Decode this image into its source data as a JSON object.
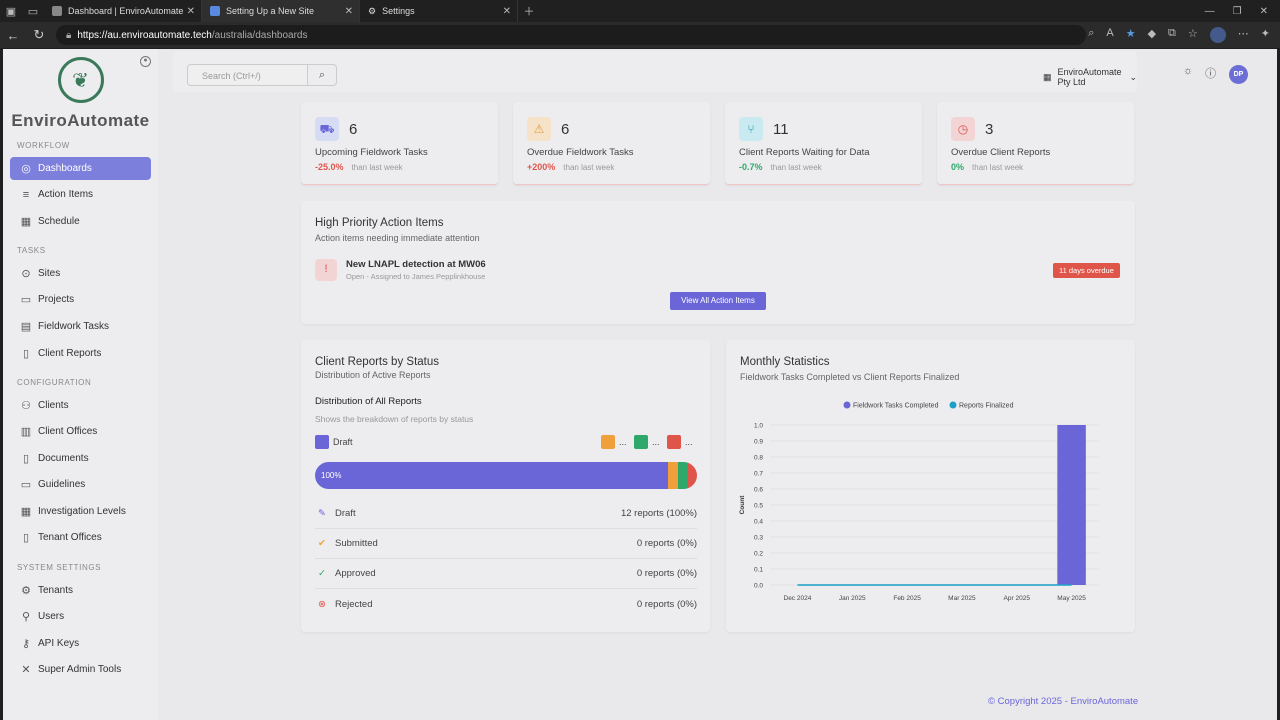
{
  "browser": {
    "tabs": [
      {
        "title": "Dashboard | EnviroAutomate",
        "active": false
      },
      {
        "title": "Setting Up a New Site",
        "active": true
      },
      {
        "title": "Settings",
        "active": false
      }
    ],
    "url_host": "https://au.enviroautomate.tech",
    "url_path": "/australia/dashboards"
  },
  "brand": {
    "name": "EnviroAutomate"
  },
  "sidebar": {
    "sections": [
      {
        "title": "WORKFLOW",
        "items": [
          {
            "label": "Dashboards",
            "icon": "dashboard-icon",
            "active": true
          },
          {
            "label": "Action Items",
            "icon": "list-icon"
          },
          {
            "label": "Schedule",
            "icon": "calendar-icon"
          }
        ]
      },
      {
        "title": "TASKS",
        "items": [
          {
            "label": "Sites",
            "icon": "location-icon"
          },
          {
            "label": "Projects",
            "icon": "folder-icon"
          },
          {
            "label": "Fieldwork Tasks",
            "icon": "clipboard-icon"
          },
          {
            "label": "Client Reports",
            "icon": "report-icon"
          }
        ]
      },
      {
        "title": "CONFIGURATION",
        "items": [
          {
            "label": "Clients",
            "icon": "users-icon"
          },
          {
            "label": "Client Offices",
            "icon": "building-icon"
          },
          {
            "label": "Documents",
            "icon": "document-icon"
          },
          {
            "label": "Guidelines",
            "icon": "book-icon"
          },
          {
            "label": "Investigation Levels",
            "icon": "chart-icon"
          },
          {
            "label": "Tenant Offices",
            "icon": "office-icon"
          }
        ]
      },
      {
        "title": "SYSTEM SETTINGS",
        "items": [
          {
            "label": "Tenants",
            "icon": "gear-icon"
          },
          {
            "label": "Users",
            "icon": "user-icon"
          },
          {
            "label": "API Keys",
            "icon": "key-icon"
          },
          {
            "label": "Super Admin Tools",
            "icon": "tools-icon"
          }
        ]
      }
    ]
  },
  "topbar": {
    "search_placeholder": "Search (Ctrl+/)",
    "company": "EnviroAutomate Pty Ltd",
    "user_initials": "DP"
  },
  "stats": [
    {
      "value": "6",
      "label": "Upcoming Fieldwork Tasks",
      "change": "-25.0%",
      "change_color": "#e0554a",
      "tail": "than last week",
      "icon": "truck-icon",
      "icon_bg": "#d7dcf5",
      "icon_color": "#6a66d8"
    },
    {
      "value": "6",
      "label": "Overdue Fieldwork Tasks",
      "change": "+200%",
      "change_color": "#e0554a",
      "tail": "than last week",
      "icon": "warning-icon",
      "icon_bg": "#f6e2c9",
      "icon_color": "#e89a3c"
    },
    {
      "value": "11",
      "label": "Client Reports Waiting for Data",
      "change": "-0.7%",
      "change_color": "#2ea86a",
      "tail": "than last week",
      "icon": "branch-icon",
      "icon_bg": "#c9eaf0",
      "icon_color": "#1a9aad"
    },
    {
      "value": "3",
      "label": "Overdue Client Reports",
      "change": "0%",
      "change_color": "#2ea86a",
      "tail": "than last week",
      "icon": "clock-icon",
      "icon_bg": "#f3d4d4",
      "icon_color": "#d9534f"
    }
  ],
  "priority": {
    "title": "High Priority Action Items",
    "subtitle": "Action items needing immediate attention",
    "item_title": "New LNAPL detection at MW06",
    "item_meta": "Open - Assigned to James Pepplinkhouse",
    "overdue": "11 days overdue",
    "button": "View All Action Items"
  },
  "reports": {
    "title": "Client Reports by Status",
    "subtitle": "Distribution of Active Reports",
    "dist_title": "Distribution of All Reports",
    "dist_sub": "Shows the breakdown of reports by status",
    "legend_main": "Draft",
    "legend_more": "...",
    "bar_label": "100%",
    "colors": {
      "draft": "#6a66d8",
      "submitted": "#f0a03a",
      "approved": "#2ea86a",
      "rejected": "#e0554a"
    },
    "rows": [
      {
        "label": "Draft",
        "value": "12 reports (100%)",
        "icon": "pencil-icon"
      },
      {
        "label": "Submitted",
        "value": "0 reports (0%)",
        "icon": "check-double-icon"
      },
      {
        "label": "Approved",
        "value": "0 reports (0%)",
        "icon": "check-circle-icon"
      },
      {
        "label": "Rejected",
        "value": "0 reports (0%)",
        "icon": "x-circle-icon"
      }
    ]
  },
  "monthly": {
    "title": "Monthly Statistics",
    "subtitle": "Fieldwork Tasks Completed vs Client Reports Finalized"
  },
  "chart_data": {
    "type": "bar",
    "categories": [
      "Dec 2024",
      "Jan 2025",
      "Feb 2025",
      "Mar 2025",
      "Apr 2025",
      "May 2025"
    ],
    "series": [
      {
        "name": "Fieldwork Tasks Completed",
        "type": "bar",
        "color": "#6a66d8",
        "values": [
          0,
          0,
          0,
          0,
          0,
          1
        ]
      },
      {
        "name": "Reports Finalized",
        "type": "line",
        "color": "#1aa0c8",
        "values": [
          0,
          0,
          0,
          0,
          0,
          0
        ]
      }
    ],
    "ylabel": "Count",
    "ylim": [
      0,
      1
    ],
    "yticks": [
      "1.0",
      "0.9",
      "0.8",
      "0.7",
      "0.6",
      "0.5",
      "0.4",
      "0.3",
      "0.2",
      "0.1",
      "0.0"
    ],
    "legend": "top-center",
    "grid": true
  },
  "footer": {
    "copyright": "© Copyright 2025 - EnviroAutomate"
  }
}
